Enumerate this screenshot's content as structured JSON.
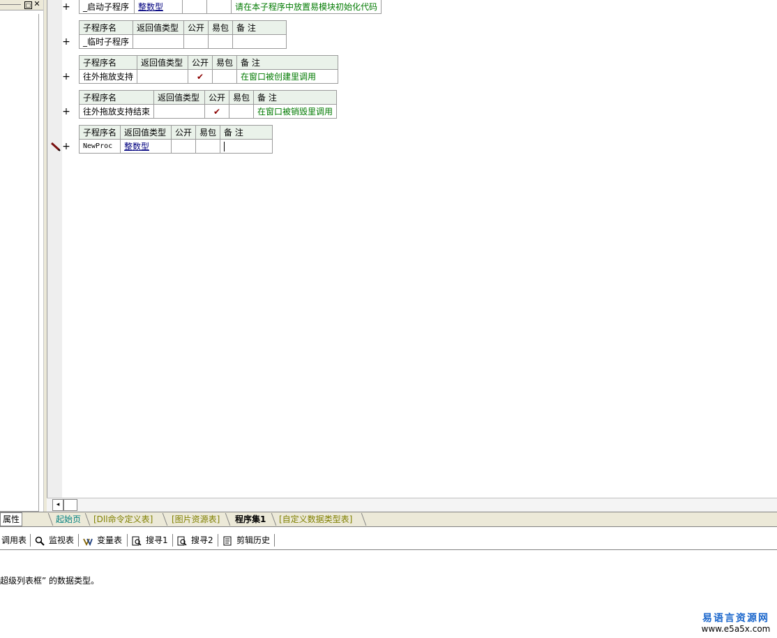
{
  "left_panel": {
    "pin_glyph": "□",
    "close_glyph": "✕",
    "tab_label": "属性"
  },
  "procedures": [
    {
      "name": "_启动子程序",
      "return_type": "整数型",
      "public": "",
      "easy_pack": "",
      "note": "请在本子程序中放置易模块初始化代码"
    },
    {
      "name": "_临时子程序",
      "return_type": "",
      "public": "",
      "easy_pack": "",
      "note": ""
    },
    {
      "name": "往外拖放支持",
      "return_type": "",
      "public": "✔",
      "easy_pack": "",
      "note": "在窗口被创建里调用"
    },
    {
      "name": "往外拖放支持结束",
      "return_type": "",
      "public": "✔",
      "easy_pack": "",
      "note": "在窗口被销毁里调用"
    },
    {
      "name": "NewProc",
      "return_type": "整数型",
      "public": "",
      "easy_pack": "",
      "note": ""
    }
  ],
  "table_headers": {
    "name": "子程序名",
    "return_type": "返回值类型",
    "public": "公开",
    "easy_pack": "易包",
    "note": "备 注"
  },
  "expand_glyph": "+",
  "scroll_left_glyph": "◂",
  "tabs": [
    {
      "label": "起始页"
    },
    {
      "label": "[Dll命令定义表]"
    },
    {
      "label": "[图片资源表]"
    },
    {
      "label": "程序集1"
    },
    {
      "label": "[自定义数据类型表]"
    }
  ],
  "toolbar": [
    {
      "label": "调用表",
      "icon": "call-table-icon"
    },
    {
      "label": "监视表",
      "icon": "magnifier-icon"
    },
    {
      "label": "变量表",
      "icon": "variable-icon"
    },
    {
      "label": "搜寻1",
      "icon": "search-doc-icon"
    },
    {
      "label": "搜寻2",
      "icon": "search-doc-icon"
    },
    {
      "label": "剪辑历史",
      "icon": "clipboard-history-icon"
    }
  ],
  "status_text": "超级列表框” 的数据类型。",
  "watermark": {
    "title": "易语言资源网",
    "url": "www.e5a5x.com"
  },
  "colors": {
    "type_blue": "#00007f",
    "note_green": "#007a00",
    "check_red": "#8b0000",
    "header_bg": "#eaf2ea"
  }
}
